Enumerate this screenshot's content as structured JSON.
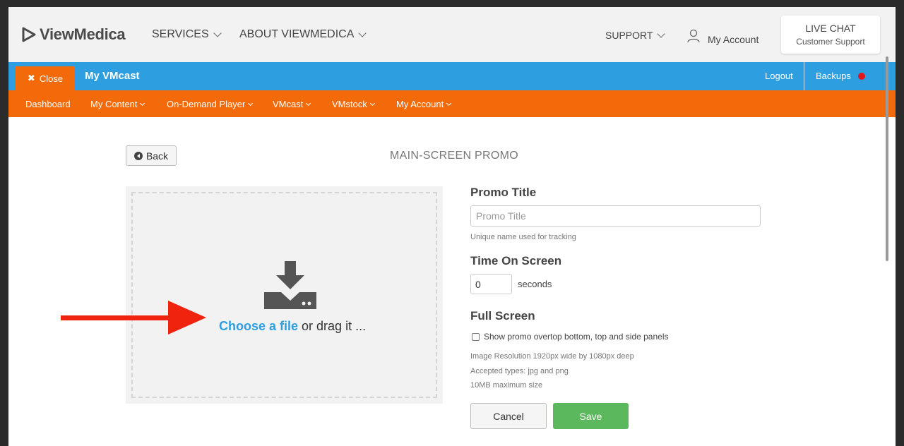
{
  "header": {
    "logo_text": "ViewMedica",
    "nav": [
      {
        "label": "SERVICES"
      },
      {
        "label": "ABOUT VIEWMEDICA"
      },
      {
        "label": "SUPPORT"
      }
    ],
    "account_label": "My Account",
    "live_chat": {
      "title": "LIVE CHAT",
      "subtitle": "Customer Support"
    }
  },
  "app_bar": {
    "close_label": "Close",
    "title": "My VMcast",
    "logout_label": "Logout",
    "backups_label": "Backups",
    "backups_dot_color": "#e0161c",
    "bar_color": "#2d9fe0"
  },
  "menu": {
    "bar_color": "#f36a0a",
    "items": [
      {
        "label": "Dashboard"
      },
      {
        "label": "My Content"
      },
      {
        "label": "On-Demand Player"
      },
      {
        "label": "VMcast"
      },
      {
        "label": "VMstock"
      },
      {
        "label": "My Account"
      }
    ]
  },
  "page": {
    "back_label": "Back",
    "title": "MAIN-SCREEN PROMO",
    "dropzone": {
      "link_text": "Choose a file",
      "rest_text": " or drag it ..."
    },
    "form": {
      "promo_title_label": "Promo Title",
      "promo_title_placeholder": "Promo Title",
      "promo_title_value": "",
      "promo_title_help": "Unique name used for tracking",
      "time_label": "Time On Screen",
      "time_value": "0",
      "time_unit": "seconds",
      "full_screen_label": "Full Screen",
      "full_screen_checkbox": "Show promo overtop bottom, top and side panels",
      "full_screen_checked": false,
      "info_lines": [
        "Image Resolution 1920px wide by 1080px deep",
        "Accepted types: jpg and png",
        "10MB maximum size"
      ],
      "cancel_label": "Cancel",
      "save_label": "Save",
      "save_color": "#5cb85c"
    }
  }
}
